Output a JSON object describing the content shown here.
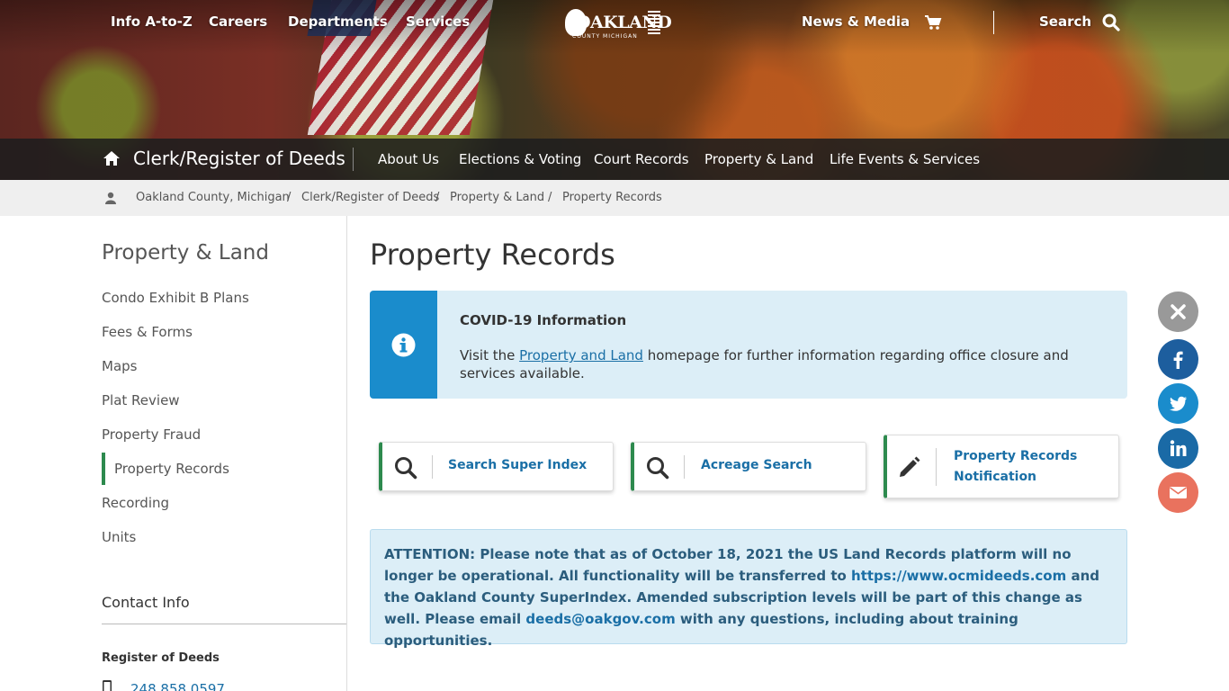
{
  "topnav": {
    "info_label": "Info A-to-Z",
    "careers_label": "Careers",
    "departments_label": "Departments",
    "services_label": "Services",
    "logo_text": "OAKLAND",
    "logo_subtext": "COUNTY MICHIGAN",
    "news_label": "News & Media",
    "search_label": "Search"
  },
  "subnav": {
    "department_title": "Clerk/Register of Deeds",
    "items": [
      "About Us",
      "Elections & Voting",
      "Court Records",
      "Property & Land",
      "Life Events & Services"
    ]
  },
  "breadcrumb": [
    "Oakland County, Michigan",
    "/",
    "Clerk/Register of Deeds",
    "/",
    "Property & Land",
    "/",
    "Property Records"
  ],
  "sidebar": {
    "title": "Property & Land",
    "items": [
      "Condo Exhibit B Plans",
      "Fees & Forms",
      "Maps",
      "Plat Review",
      "Property Fraud",
      "Property Records",
      "Recording",
      "Units"
    ],
    "active_index": 5,
    "contact_title": "Contact Info",
    "contact_subtitle": "Register of Deeds",
    "phone": "248.858.0597"
  },
  "main": {
    "title": "Property Records",
    "covid": {
      "title": "COVID-19 Information",
      "text_before": "Visit the ",
      "link_text": "Property and Land",
      "text_after": " homepage for further information regarding office closure and services available."
    },
    "buttons": [
      {
        "label": "Search Super Index",
        "icon": "search-icon"
      },
      {
        "label": "Acreage Search",
        "icon": "search-icon"
      },
      {
        "label_line1": "Property Records",
        "label_line2": "Notification",
        "icon": "pencil-icon"
      }
    ],
    "attention": {
      "part1": "ATTENTION: Please note that as of October 18, 2021 the US Land Records platform will no longer be operational. All functionality will be transferred to ",
      "link1": "https://www.ocmideeds.com",
      "part2": " and the Oakland County SuperIndex. Amended subscription levels will be part of this change as well. Please email ",
      "link2": "deeds@oakgov.com",
      "part3": " with any questions, including about training opportunities."
    }
  },
  "social": [
    {
      "name": "close",
      "color": "#999999"
    },
    {
      "name": "facebook",
      "color": "#1d5e9e"
    },
    {
      "name": "twitter",
      "color": "#1a8ccc"
    },
    {
      "name": "linkedin",
      "color": "#1a6aa6"
    },
    {
      "name": "email",
      "color": "#e9725e"
    }
  ],
  "colors": {
    "accent_green": "#2d8a4e",
    "link_blue": "#1a6fa6",
    "info_blue": "#1a8ccc",
    "alert_bg": "#dceef7"
  }
}
